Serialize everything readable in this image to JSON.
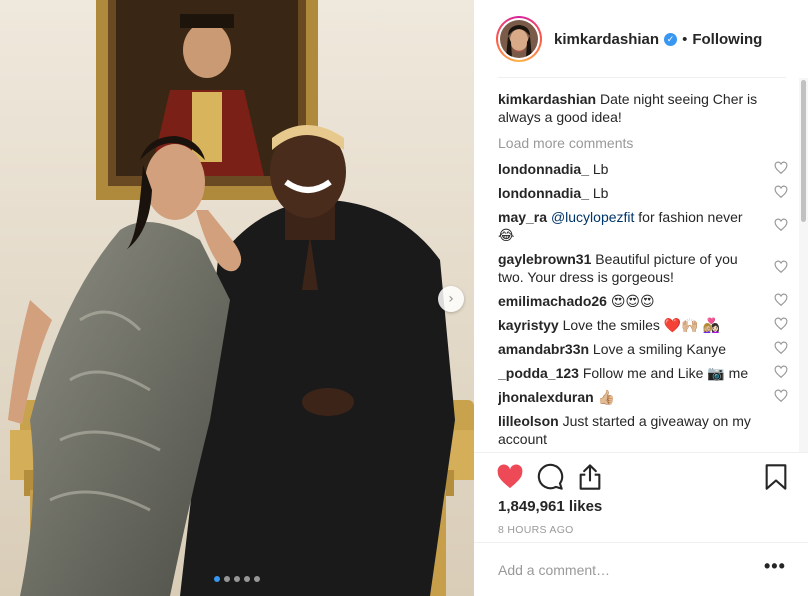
{
  "post": {
    "username": "kimkardashian",
    "separator": "•",
    "follow_status": "Following",
    "verified_mark": "✓"
  },
  "caption": {
    "username": "kimkardashian",
    "text": " Date night seeing Cher is always a good idea!"
  },
  "load_more_label": "Load more comments",
  "comments": [
    {
      "user": "londonnadia_",
      "text": " Lb"
    },
    {
      "user": "londonnadia_",
      "text": " Lb"
    },
    {
      "user": "may_ra",
      "mention": "@lucylopezfit",
      "text": " for fashion never 😂"
    },
    {
      "user": "gaylebrown31",
      "text": " Beautiful picture of you two. Your dress is gorgeous!"
    },
    {
      "user": "emilimachado26",
      "text": " 😍😍😍"
    },
    {
      "user": "kayristyy",
      "text": " Love the smiles ❤️🙌🏼 👩🏼‍❤️‍👩🏻"
    },
    {
      "user": "amandabr33n",
      "text": " Love a smiling Kanye"
    },
    {
      "user": "_podda_123",
      "text": " Follow me and Like 📷 me"
    },
    {
      "user": "jhonalexduran",
      "text": " 👍🏼"
    },
    {
      "user": "lilleolson",
      "text": " Just started a giveaway on my account"
    }
  ],
  "likes": "1,849,961 likes",
  "timestamp": "8 HOURS AGO",
  "add_comment_placeholder": "Add a comment…",
  "more_options": "•••",
  "carousel": {
    "slides": 5,
    "active": 1,
    "next_arrow": "›"
  },
  "icons": {
    "like": "heart-icon",
    "comment": "comment-icon",
    "share": "share-icon",
    "save": "bookmark-icon",
    "comment_like": "heart-outline-icon"
  },
  "colors": {
    "like_red": "#ed4956",
    "link_blue": "#003569",
    "verified_blue": "#3897f0",
    "muted_gray": "#999999"
  }
}
